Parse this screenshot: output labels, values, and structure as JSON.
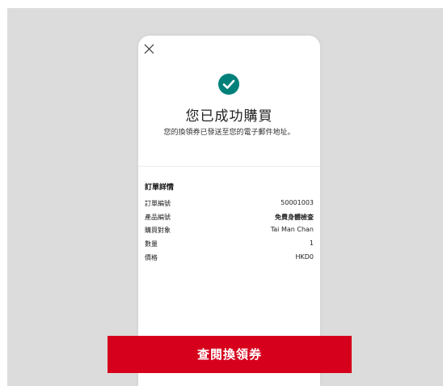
{
  "confirmation": {
    "title": "您已成功購買",
    "subtitle": "您的換領券已發送至您的電子郵件地址。"
  },
  "order": {
    "heading": "訂單詳情",
    "rows": [
      {
        "label": "訂單編號",
        "value": "50001003"
      },
      {
        "label": "產品編號",
        "value": "免費身體檢查"
      },
      {
        "label": "購買對象",
        "value": "Tai Man Chan"
      },
      {
        "label": "數量",
        "value": "1"
      },
      {
        "label": "價格",
        "value": "HKD0"
      }
    ]
  },
  "cta": {
    "label": "查閱換領券"
  },
  "icons": {
    "close": "close-icon",
    "success": "check-circle-icon"
  },
  "colors": {
    "accent": "#d6001c",
    "success": "#00807a"
  }
}
